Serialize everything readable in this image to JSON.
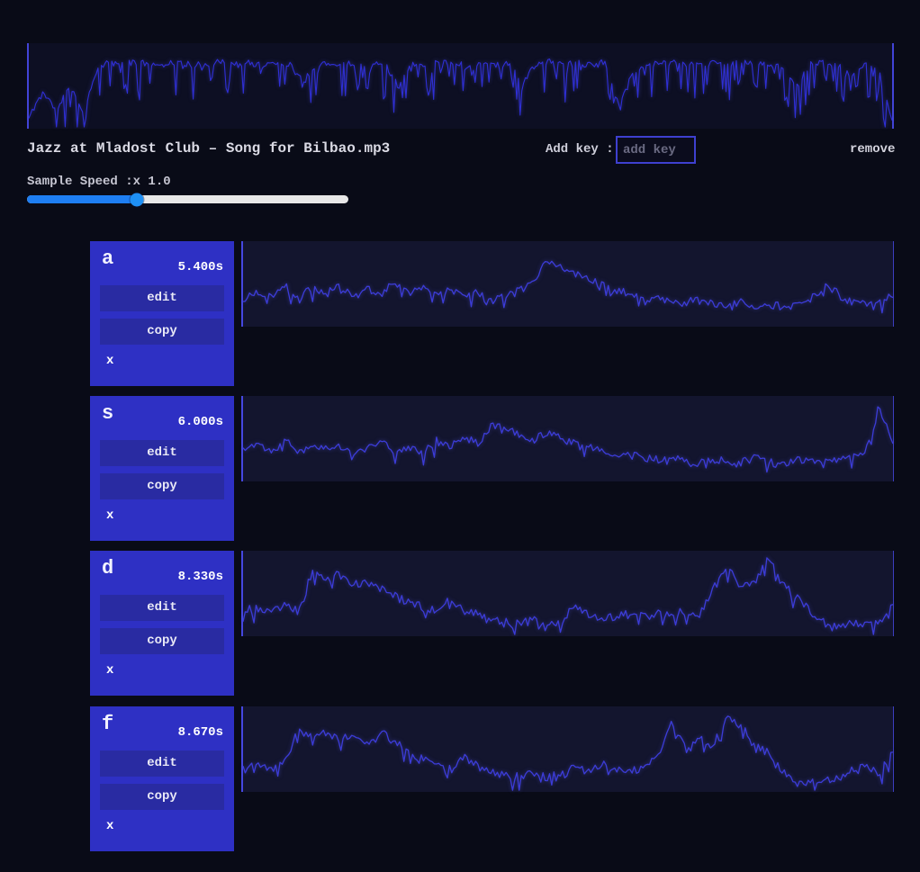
{
  "header": {
    "filename": "Jazz at Mladost Club – Song for Bilbao.mp3",
    "add_key_label": "Add key :",
    "add_key_placeholder": "add key",
    "add_key_value": "",
    "remove_label": "remove",
    "speed_label": "Sample Speed :x 1.0",
    "speed_value": "1.0",
    "slider": {
      "ratio": 0.342,
      "fill_color": "#1e7ef2",
      "track_color": "#e8e8e8",
      "thumb_color": "#1e90f5"
    }
  },
  "card_labels": {
    "edit": "edit",
    "copy": "copy",
    "delete": "x"
  },
  "colors": {
    "page_bg": "#090b17",
    "panel_bg_main": "#0d0f23",
    "panel_bg_sample": "#13152e",
    "card_bg": "#2e30c4",
    "button_bg": "#292ba2",
    "accent_border": "#3e40cf",
    "cursor_line": "#4547e0",
    "wave_main": "#2f2fd6",
    "wave_sample": "#3c3cd8"
  },
  "waveforms": {
    "main": {
      "stroke": "#2f2fd6",
      "stroke_width": 1.1,
      "points": 500,
      "seed": 11,
      "jitter": 0.035,
      "spike_prob": 0.3,
      "spike_depth": 0.42,
      "envelope": [
        0.12,
        0.45,
        0.2,
        0.52,
        0.18,
        0.72,
        0.78,
        0.76,
        0.79,
        0.75,
        0.77,
        0.78,
        0.74,
        0.76,
        0.78,
        0.75,
        0.77,
        0.74,
        0.78,
        0.76,
        0.55,
        0.77,
        0.75,
        0.78,
        0.74,
        0.77,
        0.76,
        0.48,
        0.77,
        0.75,
        0.78,
        0.76,
        0.74,
        0.77,
        0.75,
        0.78,
        0.52,
        0.76,
        0.78,
        0.75,
        0.77,
        0.74,
        0.78,
        0.3,
        0.62,
        0.77,
        0.75,
        0.78,
        0.76,
        0.74,
        0.77,
        0.75,
        0.78,
        0.76,
        0.74,
        0.77,
        0.48,
        0.75,
        0.78,
        0.76,
        0.6,
        0.77,
        0.7,
        0.08
      ]
    }
  },
  "samples": [
    {
      "key": "a",
      "duration": "5.400s",
      "wave": {
        "stroke": "#3c3cd8",
        "stroke_width": 1.3,
        "points": 300,
        "seed": 21,
        "jitter": 0.05,
        "spike_prob": 0.14,
        "spike_depth": 0.14,
        "envelope": [
          0.3,
          0.42,
          0.35,
          0.48,
          0.33,
          0.45,
          0.38,
          0.5,
          0.36,
          0.44,
          0.4,
          0.52,
          0.38,
          0.46,
          0.35,
          0.43,
          0.37,
          0.4,
          0.34,
          0.38,
          0.42,
          0.55,
          0.78,
          0.7,
          0.62,
          0.55,
          0.48,
          0.42,
          0.38,
          0.35,
          0.32,
          0.3,
          0.28,
          0.33,
          0.27,
          0.25,
          0.28,
          0.24,
          0.26,
          0.23,
          0.25,
          0.3,
          0.48,
          0.42,
          0.28,
          0.26,
          0.3,
          0.38
        ]
      }
    },
    {
      "key": "s",
      "duration": "6.000s",
      "wave": {
        "stroke": "#3c3cd8",
        "stroke_width": 1.3,
        "points": 300,
        "seed": 22,
        "jitter": 0.05,
        "spike_prob": 0.14,
        "spike_depth": 0.14,
        "envelope": [
          0.38,
          0.45,
          0.36,
          0.5,
          0.34,
          0.42,
          0.37,
          0.44,
          0.33,
          0.4,
          0.46,
          0.36,
          0.42,
          0.35,
          0.48,
          0.4,
          0.52,
          0.45,
          0.68,
          0.6,
          0.55,
          0.48,
          0.58,
          0.5,
          0.44,
          0.4,
          0.36,
          0.33,
          0.3,
          0.28,
          0.26,
          0.3,
          0.24,
          0.22,
          0.26,
          0.23,
          0.21,
          0.28,
          0.22,
          0.2,
          0.24,
          0.28,
          0.22,
          0.26,
          0.3,
          0.32,
          0.88,
          0.42
        ]
      }
    },
    {
      "key": "d",
      "duration": "8.330s",
      "wave": {
        "stroke": "#3c3cd8",
        "stroke_width": 1.3,
        "points": 300,
        "seed": 23,
        "jitter": 0.05,
        "spike_prob": 0.14,
        "spike_depth": 0.14,
        "envelope": [
          0.3,
          0.33,
          0.28,
          0.35,
          0.3,
          0.75,
          0.68,
          0.72,
          0.6,
          0.66,
          0.55,
          0.48,
          0.4,
          0.34,
          0.3,
          0.44,
          0.32,
          0.25,
          0.2,
          0.18,
          0.16,
          0.19,
          0.15,
          0.17,
          0.35,
          0.25,
          0.2,
          0.24,
          0.28,
          0.22,
          0.26,
          0.24,
          0.3,
          0.26,
          0.55,
          0.82,
          0.58,
          0.66,
          0.9,
          0.62,
          0.45,
          0.3,
          0.16,
          0.13,
          0.15,
          0.14,
          0.18,
          0.35
        ]
      }
    },
    {
      "key": "f",
      "duration": "8.670s",
      "wave": {
        "stroke": "#3c3cd8",
        "stroke_width": 1.3,
        "points": 300,
        "seed": 24,
        "jitter": 0.05,
        "spike_prob": 0.14,
        "spike_depth": 0.14,
        "envelope": [
          0.32,
          0.3,
          0.25,
          0.34,
          0.72,
          0.65,
          0.75,
          0.6,
          0.68,
          0.55,
          0.7,
          0.58,
          0.46,
          0.38,
          0.32,
          0.28,
          0.42,
          0.3,
          0.24,
          0.2,
          0.18,
          0.22,
          0.17,
          0.2,
          0.32,
          0.22,
          0.35,
          0.28,
          0.24,
          0.3,
          0.4,
          0.85,
          0.5,
          0.62,
          0.55,
          0.9,
          0.78,
          0.55,
          0.48,
          0.25,
          0.14,
          0.12,
          0.16,
          0.14,
          0.25,
          0.28,
          0.22,
          0.45
        ]
      }
    }
  ]
}
